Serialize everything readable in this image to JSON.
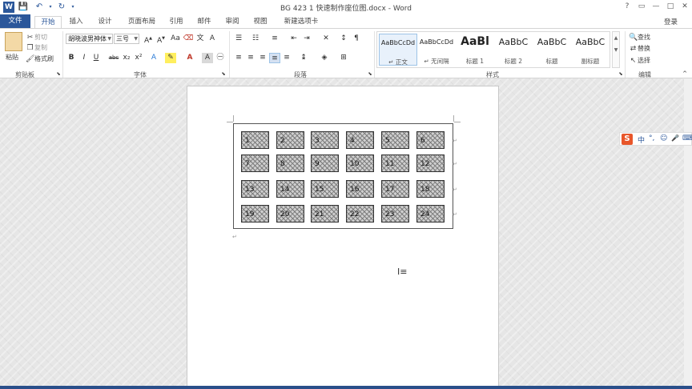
{
  "titlebar": {
    "title": "BG 423 1 快速制作座位图.docx - Word",
    "help": "?",
    "ribbon_display": "▭",
    "minimize": "—",
    "maximize": "□",
    "close": "✕"
  },
  "quick_access": {
    "word_icon": "W",
    "save": "💾",
    "undo": "↶",
    "redo": "↻",
    "customize": "▾"
  },
  "tabs": [
    {
      "label": "文件"
    },
    {
      "label": "开始"
    },
    {
      "label": "插入"
    },
    {
      "label": "设计"
    },
    {
      "label": "页面布局"
    },
    {
      "label": "引用"
    },
    {
      "label": "邮件"
    },
    {
      "label": "审阅"
    },
    {
      "label": "视图"
    },
    {
      "label": "新建选项卡"
    }
  ],
  "account": {
    "login": "登录"
  },
  "clipboard": {
    "paste": "粘贴",
    "cut": "剪切",
    "copy": "复制",
    "format_painter": "格式刷",
    "group": "剪贴板"
  },
  "font": {
    "family": "胡晓波男神体",
    "size": "三号",
    "bold": "B",
    "italic": "I",
    "underline": "U",
    "strike": "abc",
    "subscript": "x₂",
    "superscript": "x²",
    "group": "字体"
  },
  "paragraph": {
    "group": "段落"
  },
  "styles": {
    "group": "样式",
    "items": [
      {
        "sample": "AaBbCcDd",
        "name": "↵ 正文"
      },
      {
        "sample": "AaBbCcDd",
        "name": "↵ 无间隔"
      },
      {
        "sample": "AaBl",
        "name": "标题 1"
      },
      {
        "sample": "AaBbC",
        "name": "标题 2"
      },
      {
        "sample": "AaBbC",
        "name": "标题"
      },
      {
        "sample": "AaBbC",
        "name": "副标题"
      }
    ]
  },
  "editing": {
    "find": "查找",
    "replace": "替换",
    "select": "选择",
    "group": "编辑"
  },
  "document": {
    "seats": [
      "1",
      "2",
      "3",
      "4",
      "5",
      "6",
      "7",
      "8",
      "9",
      "10",
      "11",
      "12",
      "13",
      "14",
      "15",
      "16",
      "17",
      "18",
      "19",
      "20",
      "21",
      "22",
      "23",
      "24"
    ],
    "para_mark": "↵"
  },
  "ime": {
    "logo": "S",
    "lang": "中",
    "punct": "°,",
    "emoji": "☺",
    "voice": "🎤",
    "keyboard": "⌨"
  }
}
